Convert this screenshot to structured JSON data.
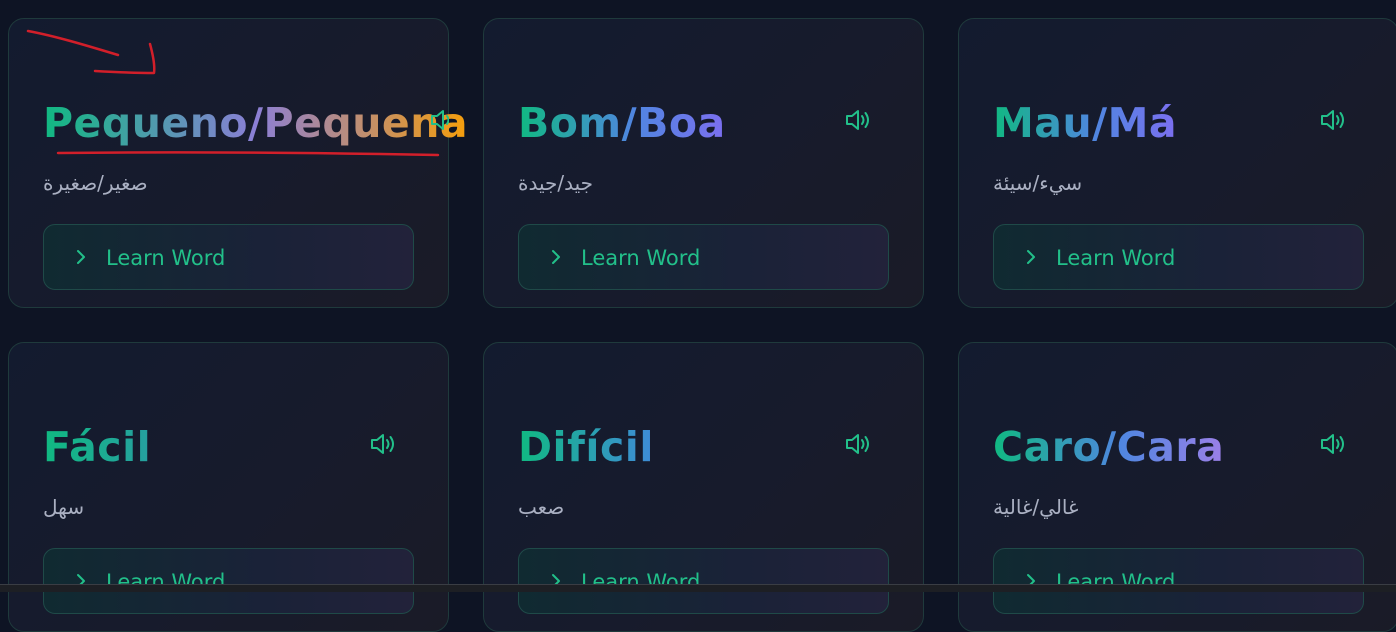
{
  "cards": [
    {
      "word": "Pequeno/Pequena",
      "translation": "صغير/صغيرة",
      "button_label": "Learn Word"
    },
    {
      "word": "Bom/Boa",
      "translation": "جيد/جيدة",
      "button_label": "Learn Word"
    },
    {
      "word": "Mau/Má",
      "translation": "سيء/سيئة",
      "button_label": "Learn Word"
    },
    {
      "word": "Fácil",
      "translation": "سهل",
      "button_label": "Learn Word"
    },
    {
      "word": "Difícil",
      "translation": "صعب",
      "button_label": "Learn Word"
    },
    {
      "word": "Caro/Cara",
      "translation": "غالي/غالية",
      "button_label": "Learn Word"
    }
  ],
  "icons": {
    "speaker": "speaker-icon",
    "chevron": "chevron-right-icon"
  },
  "colors": {
    "background": "#0e1424",
    "accent_green": "#10b981",
    "button_text": "#22c08a",
    "annotation_red": "#d21f2a"
  }
}
